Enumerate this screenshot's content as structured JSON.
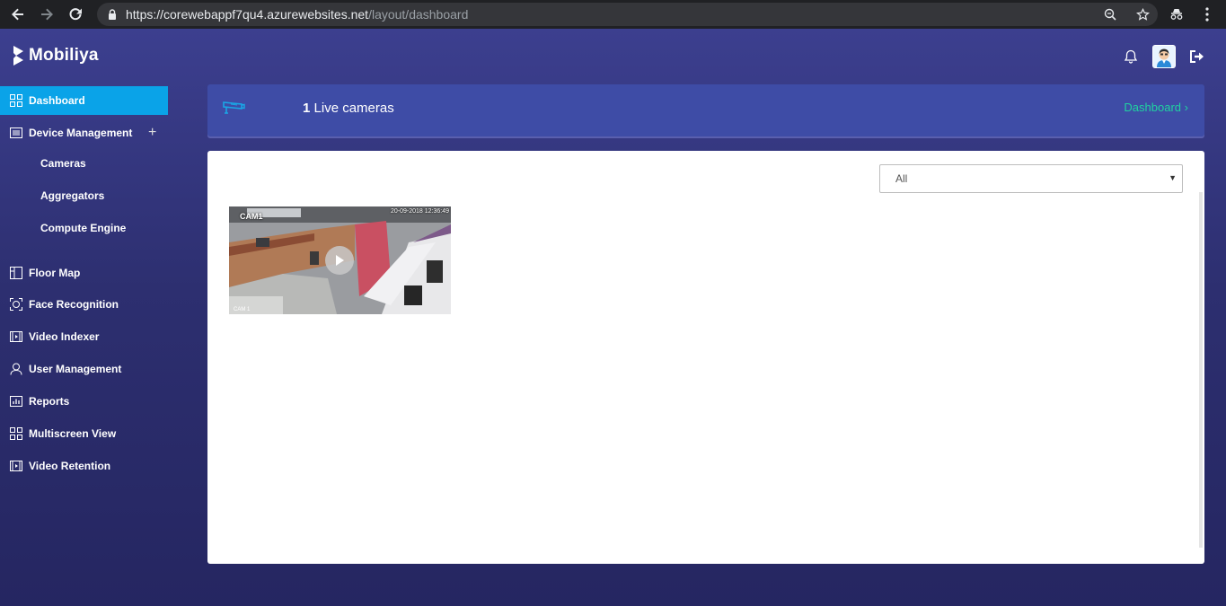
{
  "browser": {
    "url_host": "https://corewebappf7qu4.azurewebsites.net",
    "url_path": "/layout/dashboard"
  },
  "app": {
    "brand": "Mobiliya"
  },
  "sidebar": {
    "items": [
      {
        "label": "Dashboard",
        "icon": "grid-icon",
        "active": true
      },
      {
        "label": "Device Management",
        "icon": "list-icon"
      },
      {
        "label": "Floor Map",
        "icon": "floor-map-icon"
      },
      {
        "label": "Face Recognition",
        "icon": "face-scan-icon"
      },
      {
        "label": "Video Indexer",
        "icon": "film-icon"
      },
      {
        "label": "User Management",
        "icon": "user-icon"
      },
      {
        "label": "Reports",
        "icon": "bar-chart-icon"
      },
      {
        "label": "Multiscreen View",
        "icon": "grid-icon"
      },
      {
        "label": "Video Retention",
        "icon": "film-icon"
      }
    ],
    "device_sub_items": [
      "Cameras",
      "Aggregators",
      "Compute Engine"
    ],
    "expand_symbol": "+"
  },
  "banner": {
    "count": "1",
    "label": "Live cameras",
    "link": "Dashboard",
    "link_arrow": "›"
  },
  "filter": {
    "selected": "All"
  },
  "cameras": [
    {
      "label": "CAM1",
      "timestamp": "20-09-2018 12:36:49",
      "corner_label": "CAM 1"
    }
  ],
  "colors": {
    "active_nav": "#0aa3e8",
    "banner": "#3e4ca6",
    "link": "#20d2a0"
  }
}
